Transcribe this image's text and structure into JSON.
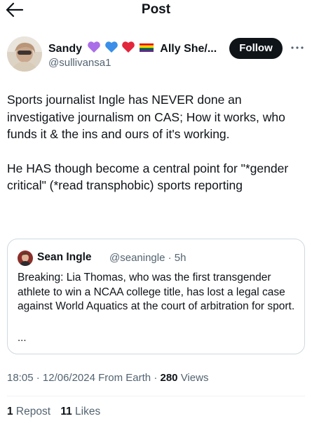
{
  "header": {
    "title": "Post",
    "back_icon": "arrow-left-icon"
  },
  "author": {
    "name": "Sandy",
    "name_emojis": [
      "purple-heart",
      "blue-heart",
      "red-heart",
      "rainbow-flag"
    ],
    "name_rest": "Ally She/...",
    "handle": "@sullivansa1",
    "follow_label": "Follow",
    "more_icon": "more-dots-icon"
  },
  "post": {
    "paragraph_1": "Sports journalist Ingle has NEVER done an investigative journalism on CAS; How it works, who funds it & the ins and ours of it's working.",
    "paragraph_2": "He HAS though become a central point for \"*gender critical\" (*read transphobic) sports reporting"
  },
  "quote": {
    "name": "Sean Ingle",
    "handle": "@seaningle",
    "separator": " · ",
    "time": "5h",
    "text": "Breaking: Lia Thomas, who was the first transgender athlete to win a NCAA college title, has lost a legal case against World Aquatics at the court of arbitration for sport.",
    "ellipsis": "..."
  },
  "meta": {
    "time": "18:05",
    "sep1": " · ",
    "date": "12/06/2024",
    "source": " From Earth",
    "sep2": " · ",
    "views_count": "280",
    "views_label": " Views"
  },
  "stats": {
    "reposts_count": "1",
    "reposts_label": " Repost",
    "likes_count": "11",
    "likes_label": " Likes"
  },
  "colors": {
    "text": "#0f1419",
    "secondary": "#536471",
    "border": "#cfd9de",
    "follow_bg": "#0f1419"
  }
}
